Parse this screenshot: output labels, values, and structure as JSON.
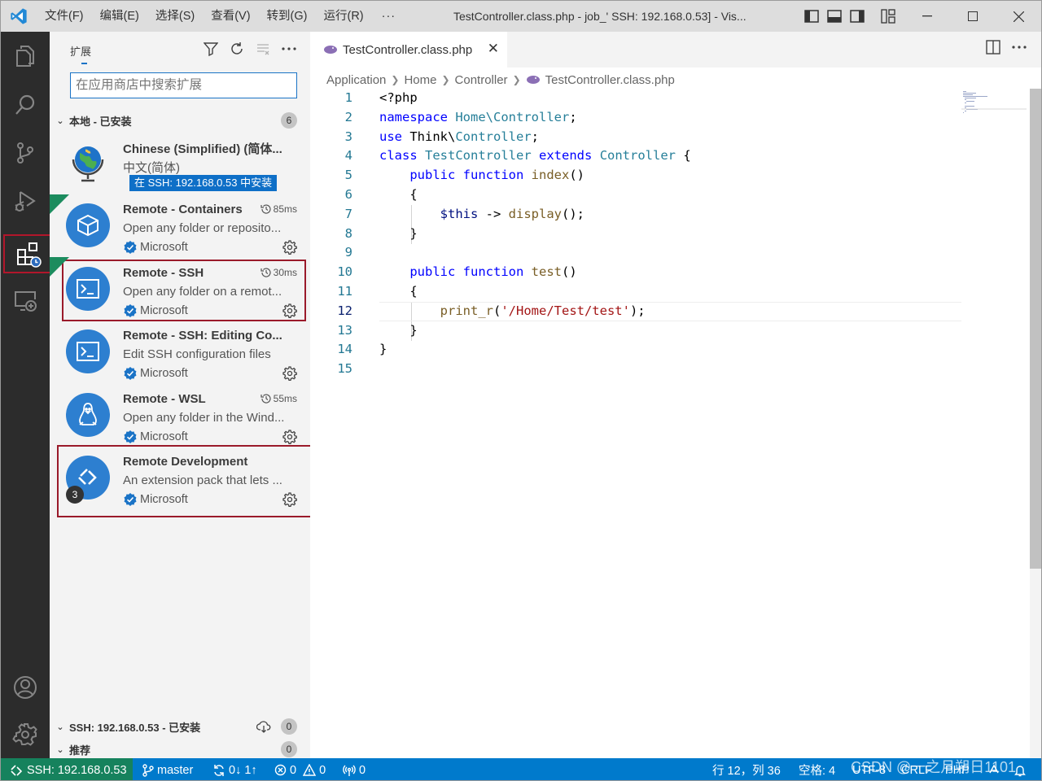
{
  "titlebar": {
    "menus": [
      "文件(F)",
      "编辑(E)",
      "选择(S)",
      "查看(V)",
      "转到(G)",
      "运行(R)"
    ],
    "more": "···",
    "title": "TestController.class.php - job_'     SSH: 192.168.0.53] - Vis..."
  },
  "sidebar": {
    "title": "扩展",
    "search_placeholder": "在应用商店中搜索扩展",
    "local_section": {
      "label": "本地 - 已安装",
      "count": "6"
    },
    "extensions": [
      {
        "name": "Chinese (Simplified) (简体...",
        "desc": "中文(简体)",
        "install_tag": "在 SSH: 192.168.0.53 中安装"
      },
      {
        "name": "Remote - Containers",
        "time": "85ms",
        "desc": "Open any folder or reposito...",
        "publisher": "Microsoft"
      },
      {
        "name": "Remote - SSH",
        "time": "30ms",
        "desc": "Open any folder on a remot...",
        "publisher": "Microsoft"
      },
      {
        "name": "Remote - SSH: Editing Co...",
        "desc": "Edit SSH configuration files",
        "publisher": "Microsoft"
      },
      {
        "name": "Remote - WSL",
        "time": "55ms",
        "desc": "Open any folder in the Wind...",
        "publisher": "Microsoft"
      },
      {
        "name": "Remote Development",
        "desc": "An extension pack that lets ...",
        "publisher": "Microsoft",
        "pack_count": "3"
      }
    ],
    "ssh_section": {
      "label": "SSH: 192.168.0.53 - 已安装",
      "count": "0"
    },
    "recommended_section": {
      "label": "推荐",
      "count": "0"
    }
  },
  "editor": {
    "tab_label": "TestController.class.php",
    "breadcrumb": [
      "Application",
      "Home",
      "Controller",
      "TestController.class.php"
    ],
    "line_numbers": [
      "1",
      "2",
      "3",
      "4",
      "5",
      "6",
      "7",
      "8",
      "9",
      "10",
      "11",
      "12",
      "13",
      "14",
      "15"
    ],
    "current_line": "12"
  },
  "statusbar": {
    "remote": "SSH: 192.168.0.53",
    "branch": "master",
    "sync": "0↓ 1↑",
    "errors": "0",
    "warnings": "0",
    "ports": "0",
    "position": "行 12，列 36",
    "spaces": "空格: 4",
    "encoding": "UTF-8",
    "eol": "CRLF",
    "language": "PHP"
  },
  "watermark": "CSDN @一之月朔日1101",
  "colors": {
    "accent": "#007acc",
    "remote_green": "#16825d",
    "highlight_red": "#9a1a2a"
  }
}
